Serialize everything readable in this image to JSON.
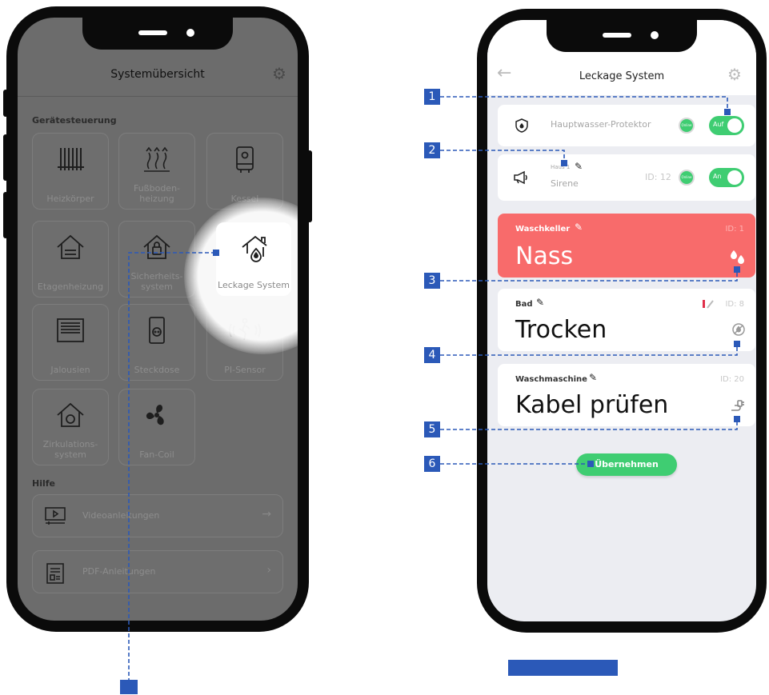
{
  "left": {
    "title": "Systemübersicht",
    "section_devices": "Gerätesteuerung",
    "tiles": [
      {
        "label": "Heizkörper",
        "icon": "radiator-icon"
      },
      {
        "label": "Fußboden-heizung",
        "icon": "floor-heating-icon"
      },
      {
        "label": "Kessel",
        "icon": "boiler-icon"
      },
      {
        "label": "Etagenheizung",
        "icon": "house-icon"
      },
      {
        "label": "Sicherheits-system",
        "icon": "security-house-icon"
      },
      {
        "label": "Leckage System",
        "icon": "leak-house-icon"
      },
      {
        "label": "Jalousien",
        "icon": "blinds-icon"
      },
      {
        "label": "Steckdose",
        "icon": "socket-icon"
      },
      {
        "label": "PI-Sensor",
        "icon": "motion-sensor-icon"
      },
      {
        "label": "Zirkulations-system",
        "icon": "circulation-house-icon"
      },
      {
        "label": "Fan-Coil",
        "icon": "fan-icon"
      }
    ],
    "section_help": "Hilfe",
    "help": [
      {
        "label": "Videoanleitungen",
        "icon": "video-icon"
      },
      {
        "label": "PDF-Anleitungen",
        "icon": "pdf-icon"
      }
    ]
  },
  "right": {
    "title": "Leckage System",
    "protector": {
      "name": "Hauptwasser-Protektor",
      "online": "Online",
      "toggle": "Auf"
    },
    "siren": {
      "house": "Haus 1",
      "name": "Sirene",
      "id": "ID: 12",
      "online": "Online",
      "toggle": "An"
    },
    "sensors": [
      {
        "name": "Waschkeller",
        "id": "ID: 1",
        "status": "Nass",
        "color": "#f86b6b"
      },
      {
        "name": "Bad",
        "id": "ID: 8",
        "status": "Trocken"
      },
      {
        "name": "Waschmaschine",
        "id": "ID: 20",
        "status": "Kabel prüfen"
      }
    ],
    "apply": "Übernehmen"
  },
  "callouts": [
    "1",
    "2",
    "3",
    "4",
    "5",
    "6"
  ],
  "colors": {
    "accent": "#2b59b8",
    "green": "#3fcd72",
    "alarm": "#f86b6b"
  }
}
